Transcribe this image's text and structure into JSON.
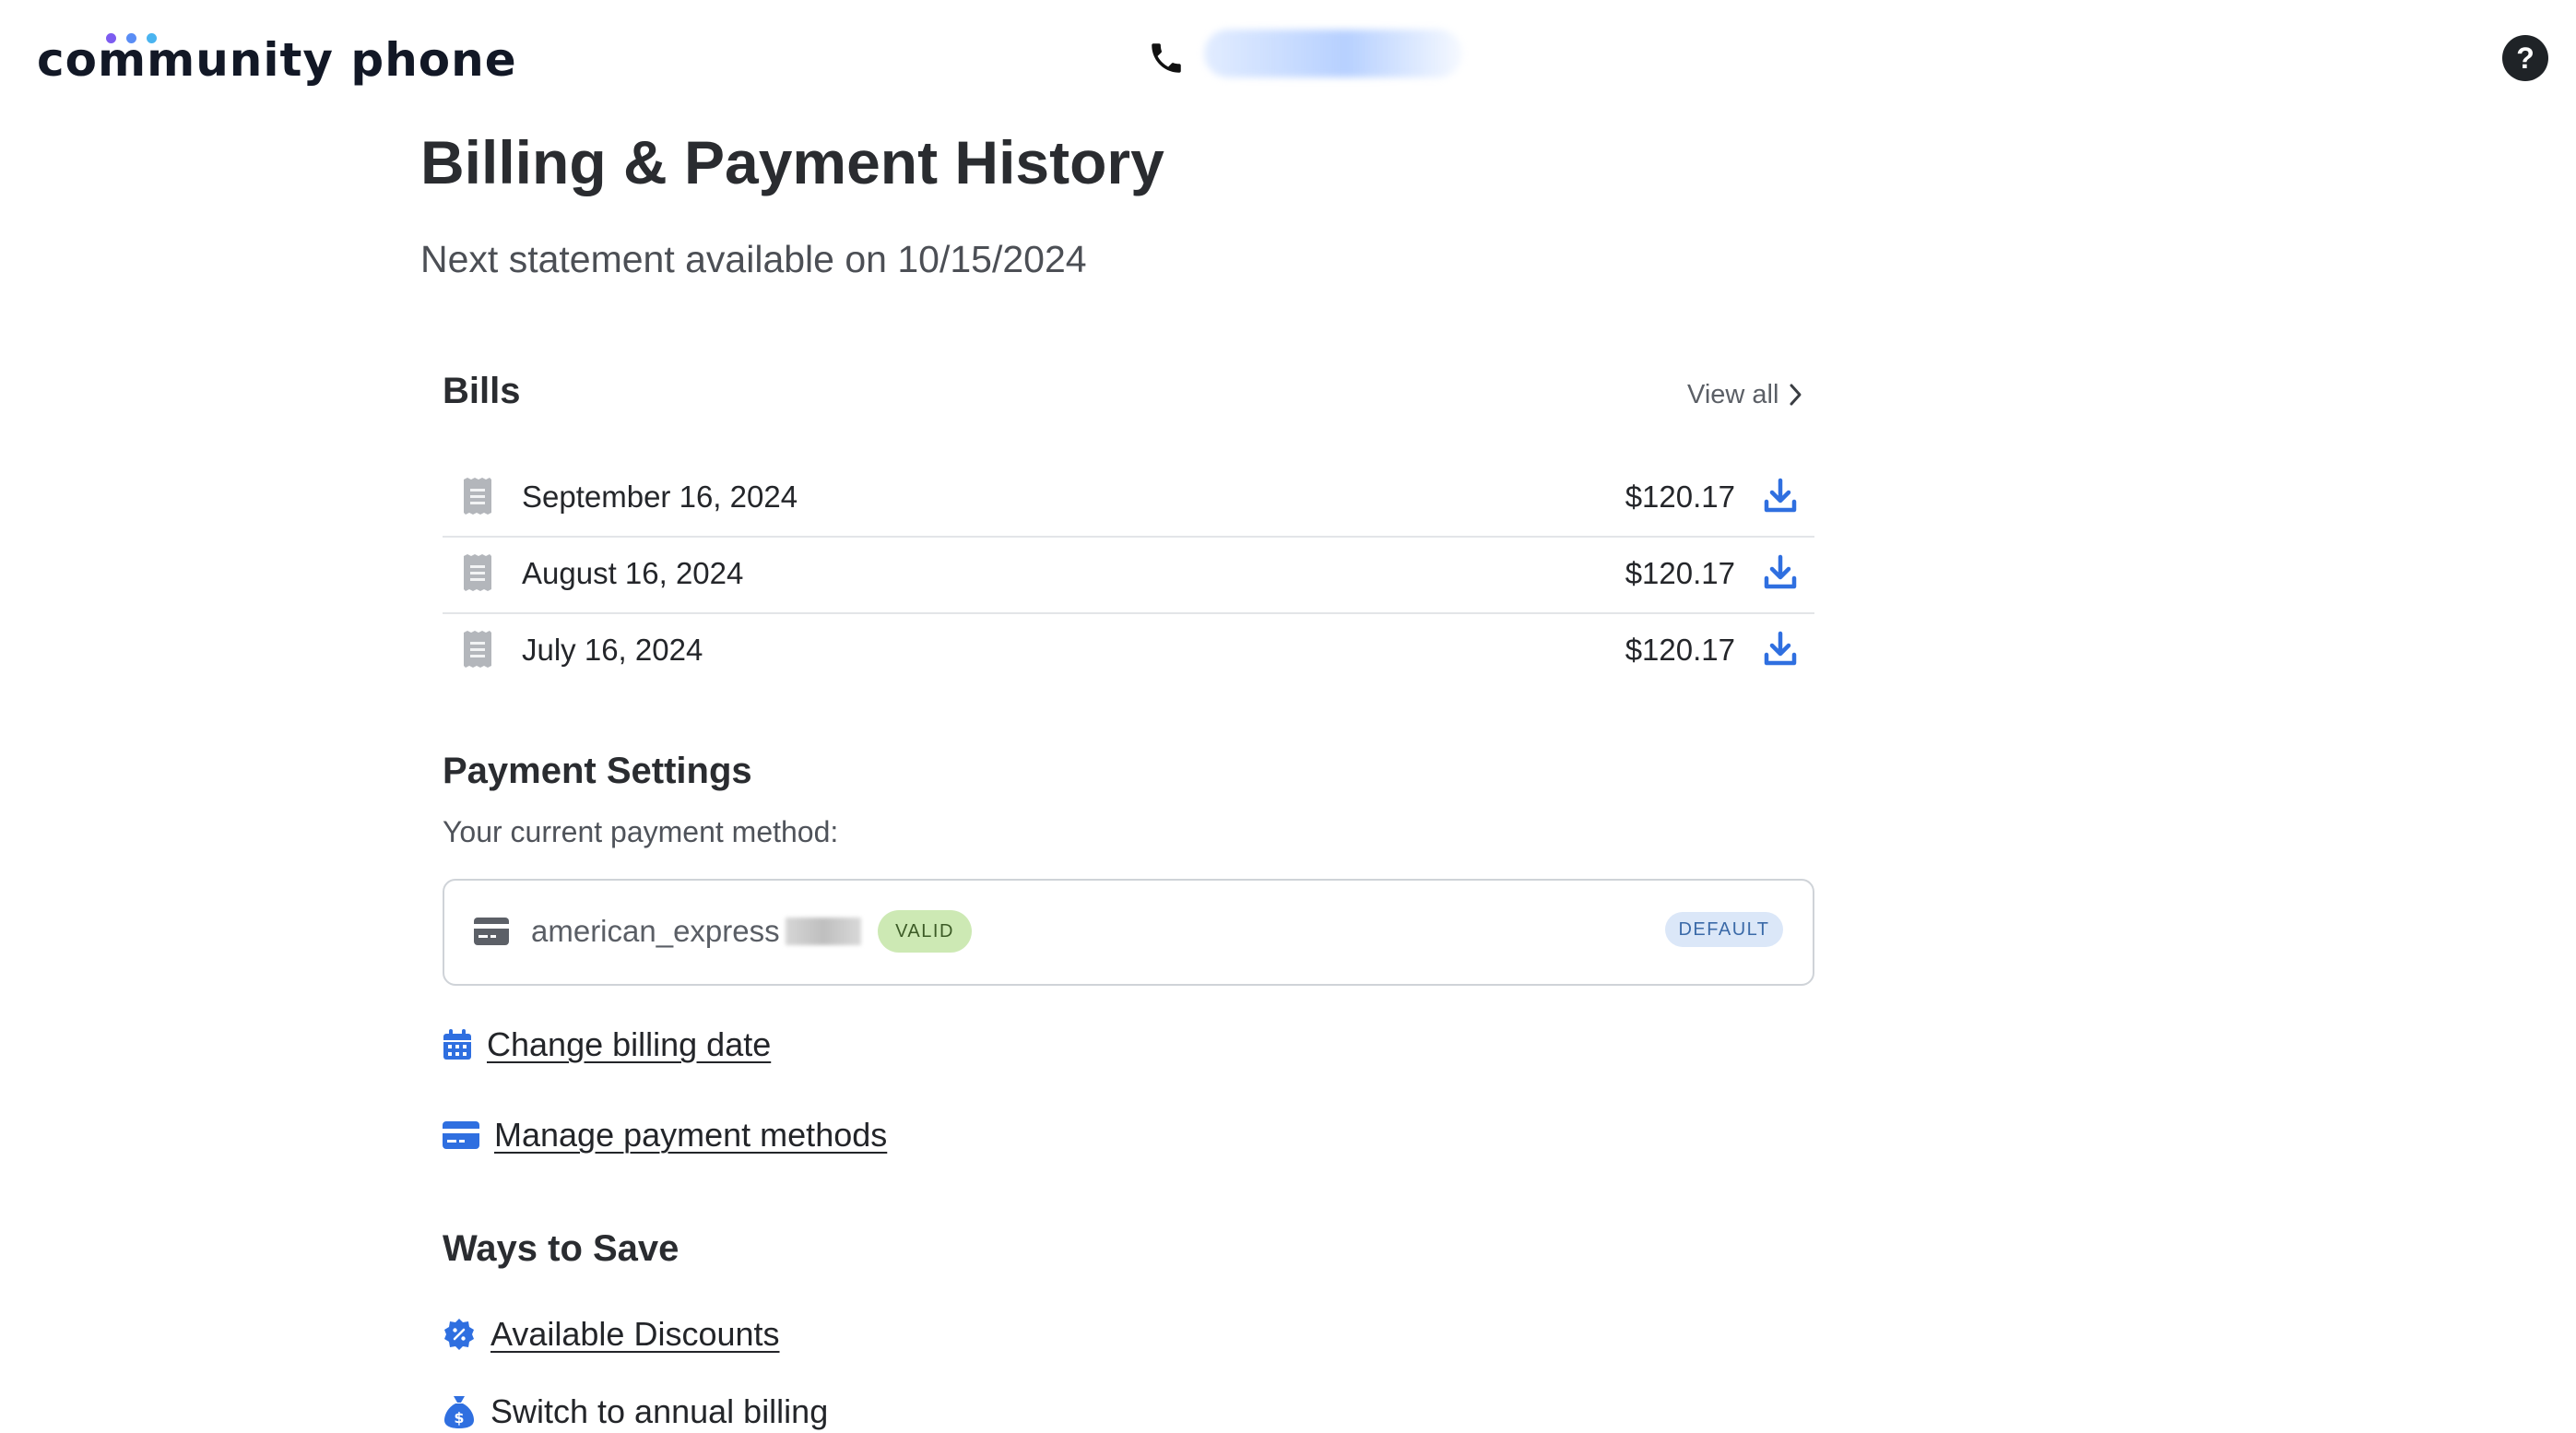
{
  "header": {
    "logo_text": "community phone",
    "logo_dot_colors": [
      "#7c5cf0",
      "#5a8df5",
      "#4ab4f0"
    ],
    "phone_icon": "phone-icon",
    "help_label": "?"
  },
  "page": {
    "title": "Billing & Payment History",
    "subtitle": "Next statement available on 10/15/2024"
  },
  "bills": {
    "title": "Bills",
    "view_all": "View all",
    "items": [
      {
        "date": "September 16, 2024",
        "amount": "$120.17"
      },
      {
        "date": "August 16, 2024",
        "amount": "$120.17"
      },
      {
        "date": "July 16, 2024",
        "amount": "$120.17"
      }
    ]
  },
  "payment": {
    "title": "Payment Settings",
    "current_label": "Your current payment method:",
    "card_name": "american_express",
    "valid_badge": "VALID",
    "default_badge": "DEFAULT",
    "change_billing_date": "Change billing date",
    "manage_methods": "Manage payment methods"
  },
  "save": {
    "title": "Ways to Save",
    "discounts": "Available Discounts",
    "annual": "Switch to annual billing"
  },
  "colors": {
    "accent_blue": "#2f6fe0",
    "icon_gray": "#a9adb3",
    "valid_green": "#cde9b4",
    "default_blue": "#dbe7f8"
  }
}
